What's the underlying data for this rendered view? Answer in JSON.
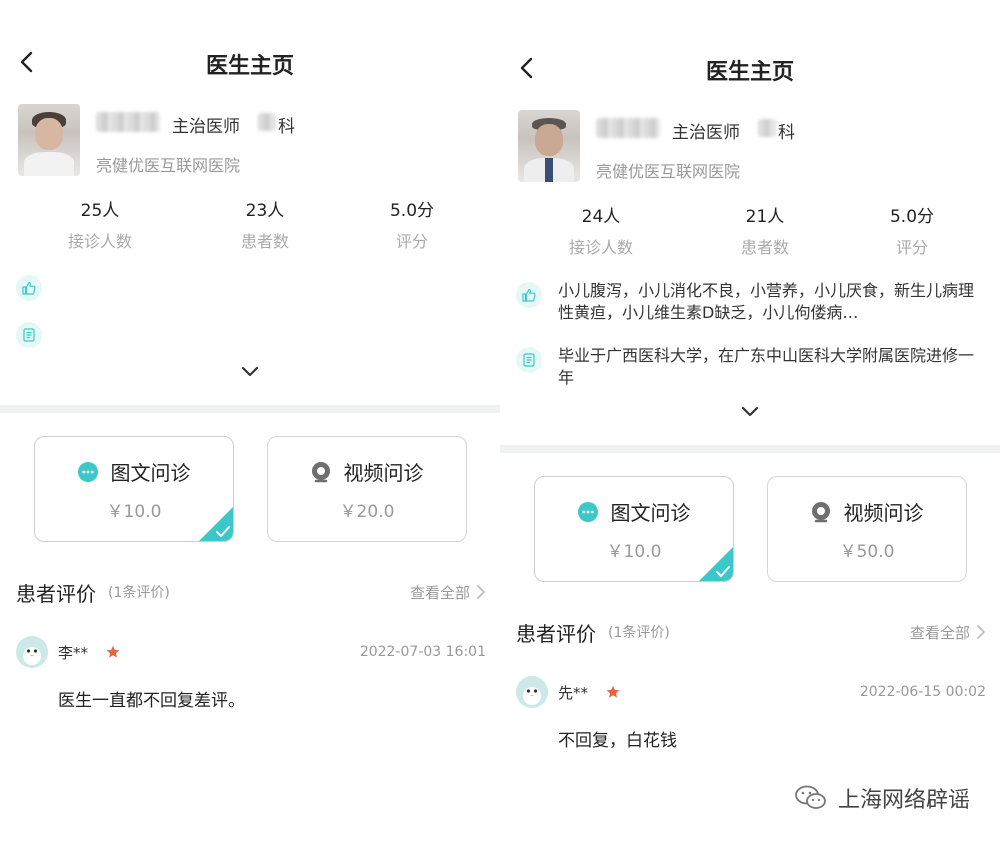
{
  "screens": [
    {
      "title": "医生主页",
      "doctor": {
        "position": "主治医师",
        "department_suffix": "科",
        "hospital": "亮健优医互联网医院"
      },
      "stats": [
        {
          "value": "25人",
          "label": "接诊人数"
        },
        {
          "value": "23人",
          "label": "患者数"
        },
        {
          "value": "5.0分",
          "label": "评分"
        }
      ],
      "specialty": "",
      "background": "",
      "services": [
        {
          "label": "图文问诊",
          "price": "￥10.0",
          "selected": true
        },
        {
          "label": "视频问诊",
          "price": "￥20.0",
          "selected": false
        }
      ],
      "reviews_section": {
        "title": "患者评价",
        "count": "(1条评价)",
        "view_all": "查看全部"
      },
      "review": {
        "name": "李**",
        "time": "2022-07-03 16:01",
        "text": "医生一直都不回复差评。"
      }
    },
    {
      "title": "医生主页",
      "doctor": {
        "position": "主治医师",
        "department_suffix": "科",
        "hospital": "亮健优医互联网医院"
      },
      "stats": [
        {
          "value": "24人",
          "label": "接诊人数"
        },
        {
          "value": "21人",
          "label": "患者数"
        },
        {
          "value": "5.0分",
          "label": "评分"
        }
      ],
      "specialty": "小儿腹泻，小儿消化不良，小营养，小儿厌食，新生儿病理性黄疸，小儿维生素D缺乏，小儿佝偻病…",
      "background": "毕业于广西医科大学，在广东中山医科大学附属医院进修一年",
      "services": [
        {
          "label": "图文问诊",
          "price": "￥10.0",
          "selected": true
        },
        {
          "label": "视频问诊",
          "price": "￥50.0",
          "selected": false
        }
      ],
      "reviews_section": {
        "title": "患者评价",
        "count": "(1条评价)",
        "view_all": "查看全部"
      },
      "review": {
        "name": "先**",
        "time": "2022-06-15 00:02",
        "text": "不回复，白花钱"
      }
    }
  ],
  "watermark": "上海网络辟谣",
  "colors": {
    "accent": "#3cc8c8",
    "accent_light": "#e6f7f7",
    "star": "#e8623c",
    "divider": "#eef3f2"
  },
  "icons": {
    "back": "chevron-left-icon",
    "expand": "chevron-down-icon",
    "specialty": "thumbs-up-icon",
    "background": "document-icon",
    "text_consult": "chat-bubble-icon",
    "video_consult": "video-camera-icon",
    "selected": "check-icon",
    "star": "star-icon",
    "watermark": "wechat-icon"
  }
}
